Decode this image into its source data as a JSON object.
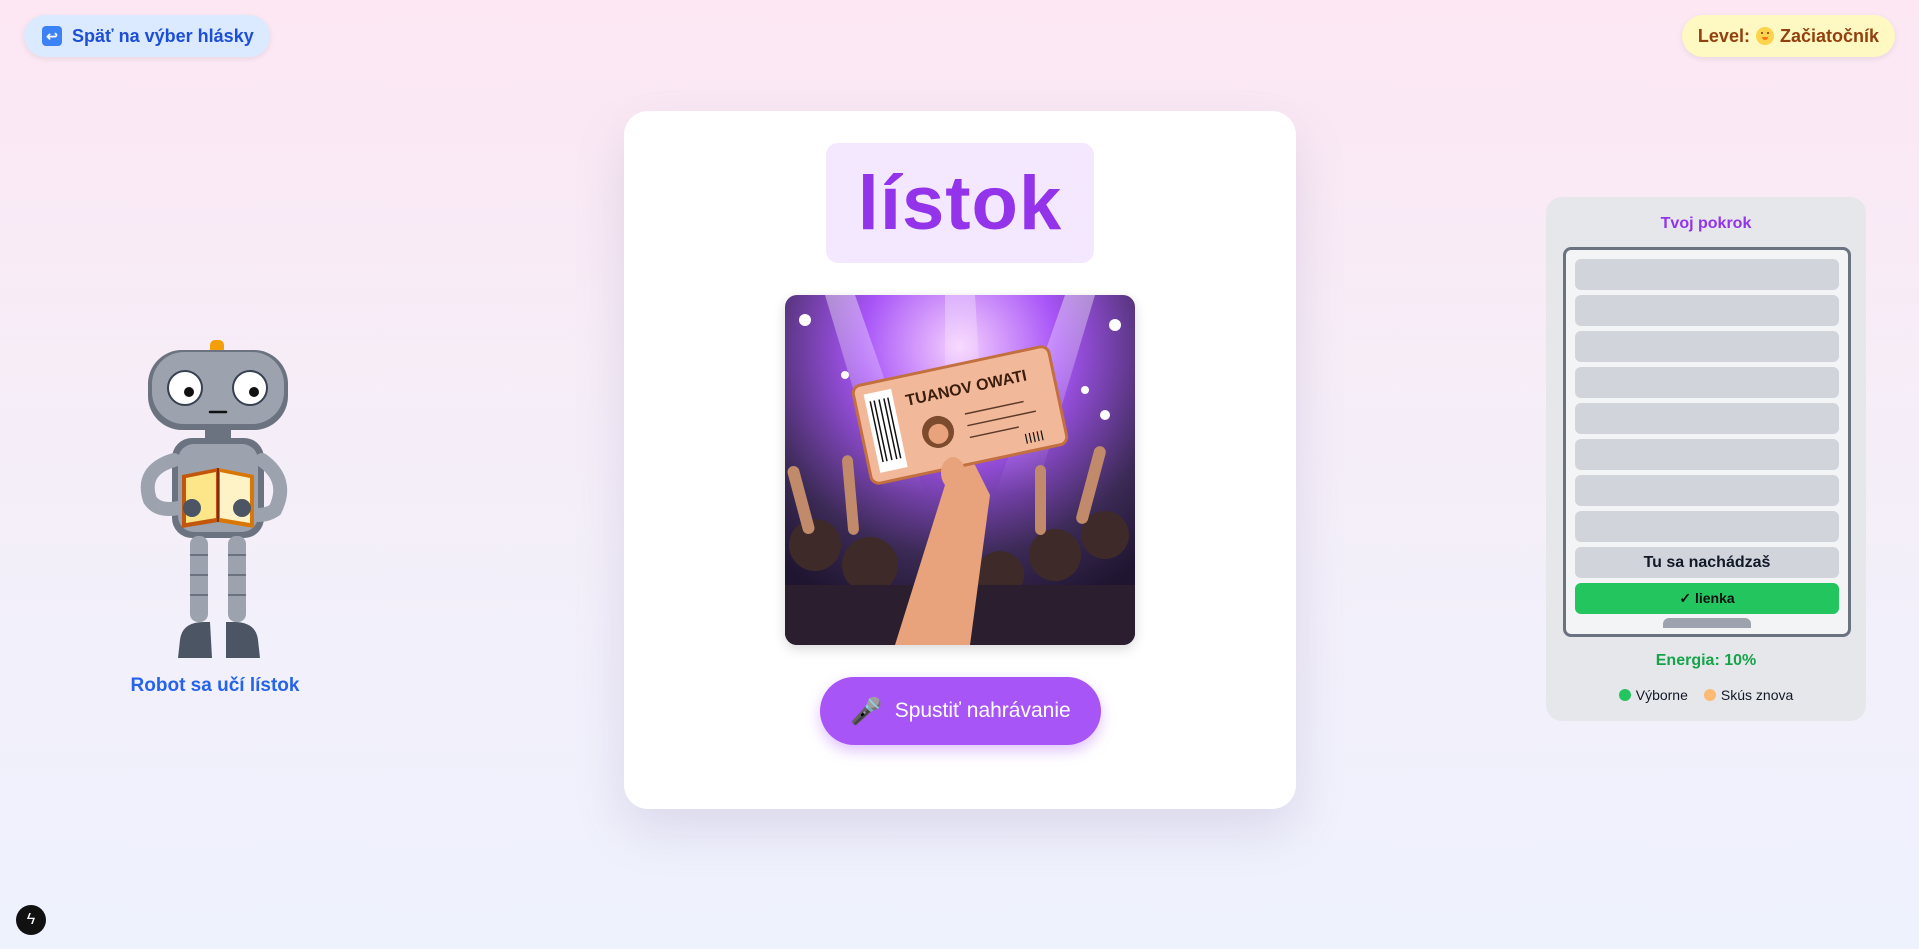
{
  "header": {
    "back_label": "Späť na výber hlásky",
    "back_icon": "return-arrow-icon",
    "level_prefix": "Level:",
    "level_icon": "baby-face-icon",
    "level_value": "Začiatočník"
  },
  "robot": {
    "label": "Robot sa učí lístok"
  },
  "card": {
    "word": "lístok",
    "image_alt": "Ruka držiaca vstupenku na koncerte",
    "ticket_text": "TUANOV OWATI",
    "record_label": "Spustiť nahrávanie",
    "record_icon": "microphone-icon"
  },
  "progress": {
    "title": "Tvoj pokrok",
    "current_label": "Tu sa nachádzaš",
    "completed_label": "✓ lienka",
    "energy": "Energia: 10%",
    "energy_value": 0.1,
    "legend": [
      {
        "label": "Výborne",
        "color": "#22c55e"
      },
      {
        "label": "Skús znova",
        "color": "#fdba74"
      }
    ]
  },
  "colors": {
    "accent": "#a855f7",
    "word": "#9333ea",
    "success": "#22c55e",
    "link": "#2563eb"
  }
}
